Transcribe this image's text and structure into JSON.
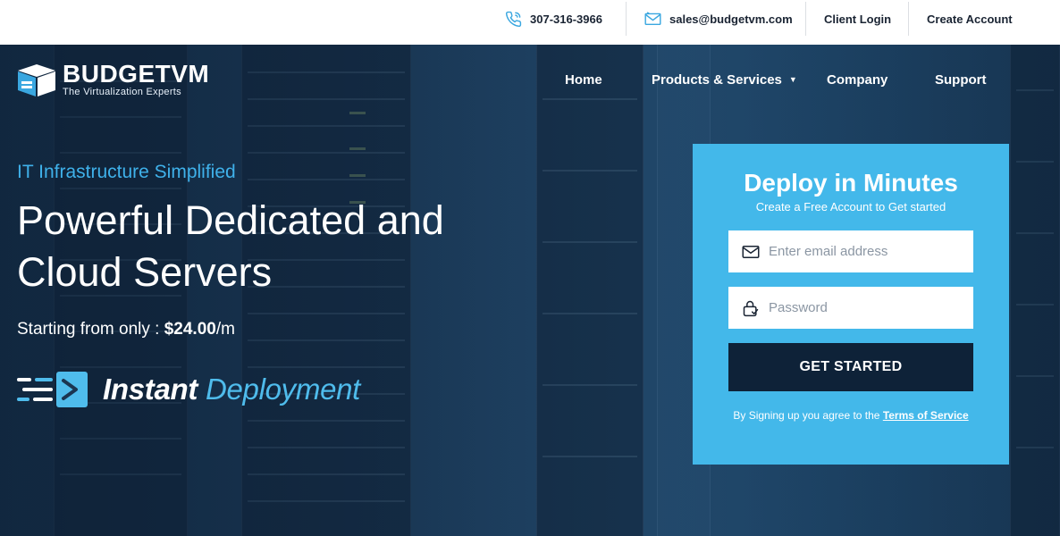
{
  "topbar": {
    "phone": "307-316-3966",
    "email": "sales@budgetvm.com",
    "client_login": "Client Login",
    "create_account": "Create Account"
  },
  "logo": {
    "name": "BUDGETVM",
    "tagline": "The Virtualization Experts"
  },
  "nav": {
    "items": [
      {
        "label": "Home"
      },
      {
        "label": "Products & Services",
        "has_dropdown": true
      },
      {
        "label": "Company"
      },
      {
        "label": "Support"
      }
    ]
  },
  "hero": {
    "eyebrow": "IT Infrastructure Simplified",
    "headline_line1": "Powerful Dedicated and",
    "headline_line2": "Cloud Servers",
    "price_prefix": "Starting from only : ",
    "price_value": "$24.00",
    "price_suffix": "/m",
    "instant_word1": "Instant",
    "instant_word2": "Deployment"
  },
  "signup": {
    "title": "Deploy in Minutes",
    "subtitle": "Create a Free Account to Get started",
    "email_placeholder": "Enter email address",
    "password_placeholder": "Password",
    "cta_label": "GET STARTED",
    "terms_prefix": "By Signing up you agree to the ",
    "terms_link": "Terms of Service"
  },
  "colors": {
    "accent": "#43b8ea",
    "eyebrow": "#3fb1ea",
    "cta_bg": "#0e2238",
    "topbar_bg": "#ffffff",
    "icon_blue": "#3aa7e0"
  },
  "icons": {
    "phone": "phone-icon",
    "email": "envelope-icon",
    "email_field": "envelope-icon",
    "password_field": "lock-icon",
    "instant": "fast-server-icon",
    "logo": "cube-logo-icon"
  }
}
